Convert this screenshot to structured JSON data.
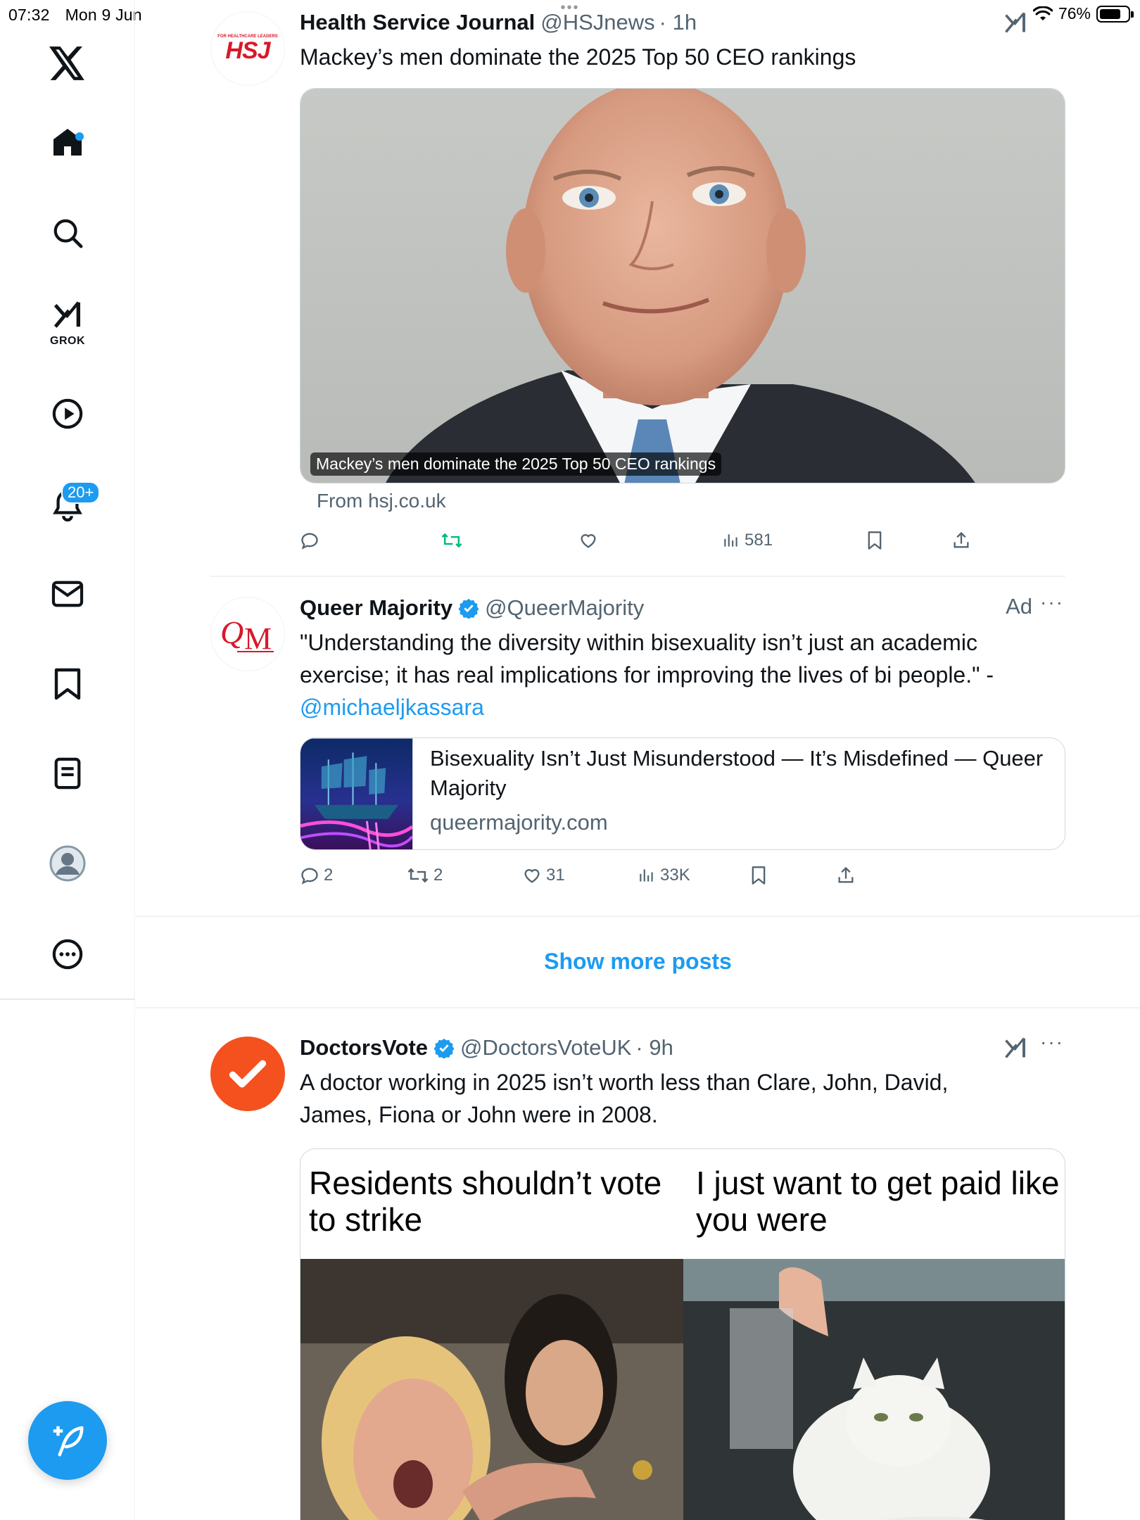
{
  "status_bar": {
    "time": "07:32",
    "date": "Mon 9 Jun",
    "battery": "76%",
    "battery_level": 0.76
  },
  "sidebar": {
    "grok_label": "GROK",
    "notifications_badge": "20+",
    "items": [
      {
        "name": "x-logo-icon"
      },
      {
        "name": "home-icon"
      },
      {
        "name": "search-icon"
      },
      {
        "name": "grok-icon"
      },
      {
        "name": "video-icon"
      },
      {
        "name": "notifications-icon"
      },
      {
        "name": "messages-icon"
      },
      {
        "name": "bookmarks-icon"
      },
      {
        "name": "lists-icon"
      },
      {
        "name": "profile-icon"
      },
      {
        "name": "more-icon"
      }
    ],
    "compose_icon": "compose-icon"
  },
  "posts": [
    {
      "author": "Health Service Journal",
      "handle": "@HSJnews",
      "time": "· 1h",
      "text": "Mackey’s men dominate the 2025 Top 50 CEO rankings",
      "avatar_text": "HSJ",
      "avatar_small_text": "FOR HEALTHCARE LEADERS",
      "image_caption": "Mackey’s men dominate the 2025 Top 50 CEO rankings",
      "from": "From hsj.co.uk",
      "stats": {
        "replies": "",
        "reposts": "",
        "likes": "",
        "views": "581"
      }
    },
    {
      "author": "Queer Majority",
      "handle": "@QueerMajority",
      "ad_label": "Ad",
      "text": "\"Understanding the diversity within bisexuality isn’t just an academic exercise; it has real implications for improving the lives of bi people.\" -",
      "mention": "@michaeljkassara",
      "card": {
        "title": "Bisexuality Isn’t Just Misunderstood — It’s Misdefined — Queer Majority",
        "domain": "queermajority.com"
      },
      "stats": {
        "replies": "2",
        "reposts": "2",
        "likes": "31",
        "views": "33K"
      }
    },
    {
      "author": "DoctorsVote",
      "handle": "@DoctorsVoteUK",
      "time": "· 9h",
      "text": "A doctor working in 2025 isn’t worth less than Clare, John, David, James, Fiona or John were in 2008.",
      "meme_left": "Residents shouldn’t vote to strike",
      "meme_right": "I just want to get paid like you were"
    }
  ],
  "show_more": "Show more posts",
  "colors": {
    "accent": "#1d9bf0",
    "repost_green": "#00ba7c",
    "doctorsvote_orange": "#f4511e",
    "hsj_red": "#d7192a"
  }
}
